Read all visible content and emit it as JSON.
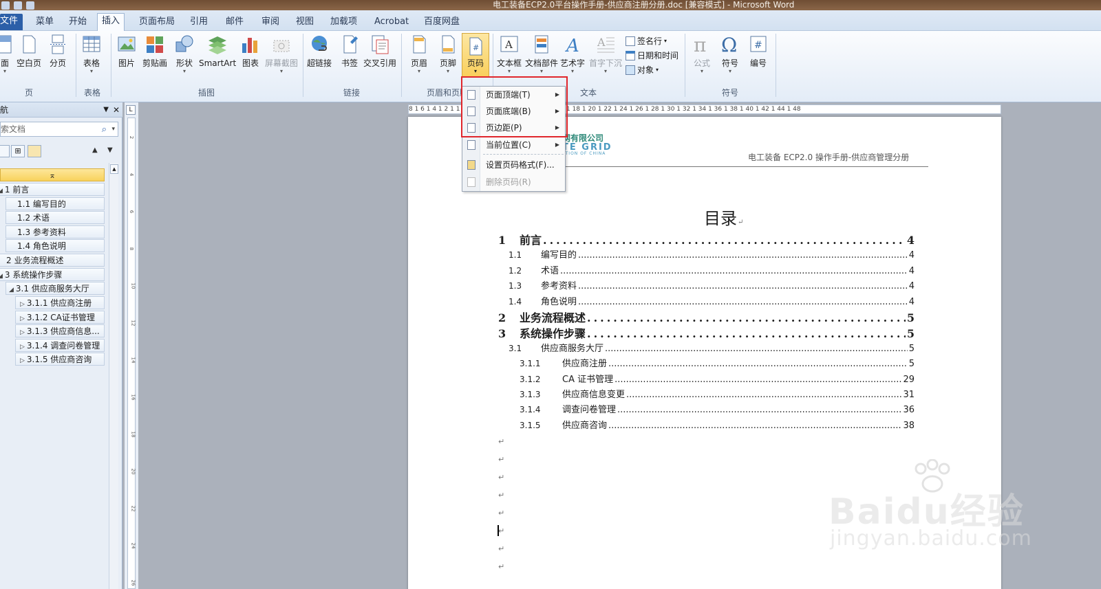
{
  "window": {
    "title": "电工装备ECP2.0平台操作手册-供应商注册分册.doc [兼容模式] - Microsoft Word"
  },
  "tabs": [
    {
      "label": "文件"
    },
    {
      "label": "菜单"
    },
    {
      "label": "开始"
    },
    {
      "label": "插入"
    },
    {
      "label": "页面布局"
    },
    {
      "label": "引用"
    },
    {
      "label": "邮件"
    },
    {
      "label": "审阅"
    },
    {
      "label": "视图"
    },
    {
      "label": "加载项"
    },
    {
      "label": "Acrobat"
    },
    {
      "label": "百度网盘"
    }
  ],
  "ribbon": {
    "pages_group": {
      "label": "页",
      "buttons": [
        "面",
        "空白页",
        "分页"
      ]
    },
    "table_group": {
      "label": "表格",
      "buttons": [
        "表格"
      ]
    },
    "illus_group": {
      "label": "插图",
      "buttons": [
        "图片",
        "剪贴画",
        "形状",
        "SmartArt",
        "图表",
        "屏幕截图"
      ]
    },
    "links_group": {
      "label": "链接",
      "buttons": [
        "超链接",
        "书签",
        "交叉引用"
      ]
    },
    "hf_group": {
      "label": "页眉和页脚",
      "buttons": [
        "页眉",
        "页脚",
        "页码"
      ]
    },
    "text_group": {
      "label": "文本",
      "buttons": [
        "文本框",
        "文档部件",
        "艺术字",
        "首字下沉"
      ],
      "small": [
        "签名行",
        "日期和时间",
        "对象"
      ]
    },
    "symbol_group": {
      "label": "符号",
      "buttons": [
        "公式",
        "符号",
        "编号"
      ]
    }
  },
  "page_number_menu": {
    "items": [
      {
        "label": "页面顶端(T)"
      },
      {
        "label": "页面底端(B)"
      },
      {
        "label": "页边距(P)"
      },
      {
        "label": "当前位置(C)"
      },
      {
        "label": "设置页码格式(F)..."
      },
      {
        "label": "删除页码(R)"
      }
    ]
  },
  "nav": {
    "title": "导航",
    "search_placeholder": "搜索文档",
    "tree": [
      {
        "label": "1 前言"
      },
      {
        "label": "1.1 编写目的"
      },
      {
        "label": "1.2 术语"
      },
      {
        "label": "1.3 参考资料"
      },
      {
        "label": "1.4 角色说明"
      },
      {
        "label": "2 业务流程概述"
      },
      {
        "label": "3 系统操作步骤"
      },
      {
        "label": "3.1 供应商服务大厅"
      },
      {
        "label": "3.1.1 供应商注册"
      },
      {
        "label": "3.1.2 CA证书管理"
      },
      {
        "label": "3.1.3 供应商信息..."
      },
      {
        "label": "3.1.4 调查问卷管理"
      },
      {
        "label": "3.1.5 供应商咨询"
      }
    ]
  },
  "ruler": {
    "text": "8 1 6 1 4 1 2 1 1 2 1 4 1 6 1 8 1 10 1 12 1 14 1 16 1 18 1 20 1 22 1 24 1 26 1 28 1 30 1 32 1 34 1 36 1 38 1 40 1 42 1 44 1 48",
    "vnums": [
      "2",
      "4",
      "6",
      "8",
      "10",
      "12",
      "14",
      "16",
      "18",
      "20",
      "22",
      "24",
      "26"
    ]
  },
  "document": {
    "header_logo_line1": "网有限公司",
    "header_logo_line2": "TE GRID",
    "header_logo_line3": "ATION OF CHINA",
    "header_text": "电工装备 ECP2.0 操作手册-供应商管理分册",
    "toc_title": "目录",
    "toc": [
      {
        "level": 1,
        "num": "1",
        "text": "前言",
        "page": "4"
      },
      {
        "level": 2,
        "num": "1.1",
        "text": "编写目的",
        "page": "4"
      },
      {
        "level": 2,
        "num": "1.2",
        "text": "术语",
        "page": "4"
      },
      {
        "level": 2,
        "num": "1.3",
        "text": "参考资料",
        "page": "4"
      },
      {
        "level": 2,
        "num": "1.4",
        "text": "角色说明",
        "page": "4"
      },
      {
        "level": 1,
        "num": "2",
        "text": "业务流程概述",
        "page": "5"
      },
      {
        "level": 1,
        "num": "3",
        "text": "系统操作步骤",
        "page": "5"
      },
      {
        "level": 2,
        "num": "3.1",
        "text": "供应商服务大厅",
        "page": "5"
      },
      {
        "level": 3,
        "num": "3.1.1",
        "text": "供应商注册",
        "page": "5"
      },
      {
        "level": 3,
        "num": "3.1.2",
        "text": "CA 证书管理",
        "page": "29"
      },
      {
        "level": 3,
        "num": "3.1.3",
        "text": "供应商信息变更",
        "page": "31"
      },
      {
        "level": 3,
        "num": "3.1.4",
        "text": "调查问卷管理",
        "page": "36"
      },
      {
        "level": 3,
        "num": "3.1.5",
        "text": "供应商咨询",
        "page": "38"
      }
    ],
    "para_mark": "↵"
  },
  "watermark": {
    "brand": "Baidu经验",
    "site": "jingyan.baidu.com"
  },
  "colors": {
    "accent": "#2c5fa8",
    "highlight": "#e0252b",
    "selected": "#f9cf5c"
  }
}
